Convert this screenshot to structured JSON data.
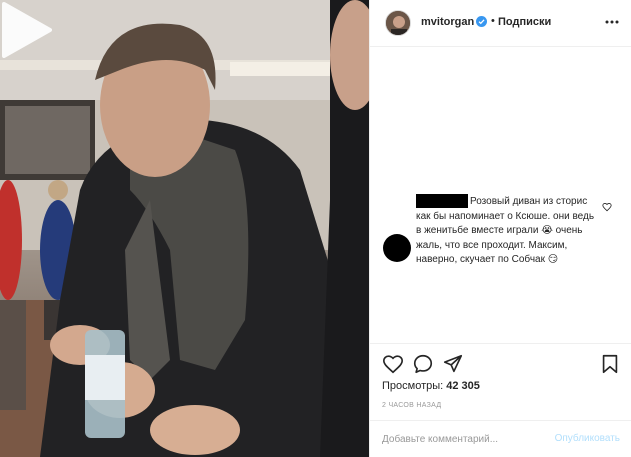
{
  "post": {
    "username": "mvitorgan",
    "separator": "•",
    "follow_label": "Подписки",
    "more_icon": "ellipsis-icon",
    "verified_color": "#3897f0"
  },
  "comment": {
    "text": "Розовый диван из сторис как бы напоминает о Ксюше. они ведь в женитьбе вместе играли 😭 очень жаль, что все проходит. Максим, наверно, скучает по Собчак 😏"
  },
  "stats": {
    "views_label": "Просмотры:",
    "views_value": "42 305",
    "time_ago": "2 ЧАСОВ НАЗАД"
  },
  "composer": {
    "placeholder": "Добавьте комментарий...",
    "publish_label": "Опубликовать"
  },
  "colors": {
    "accent": "#3897f0",
    "publish_disabled": "#b2dffc",
    "muted": "#999999",
    "border": "#efefef"
  }
}
